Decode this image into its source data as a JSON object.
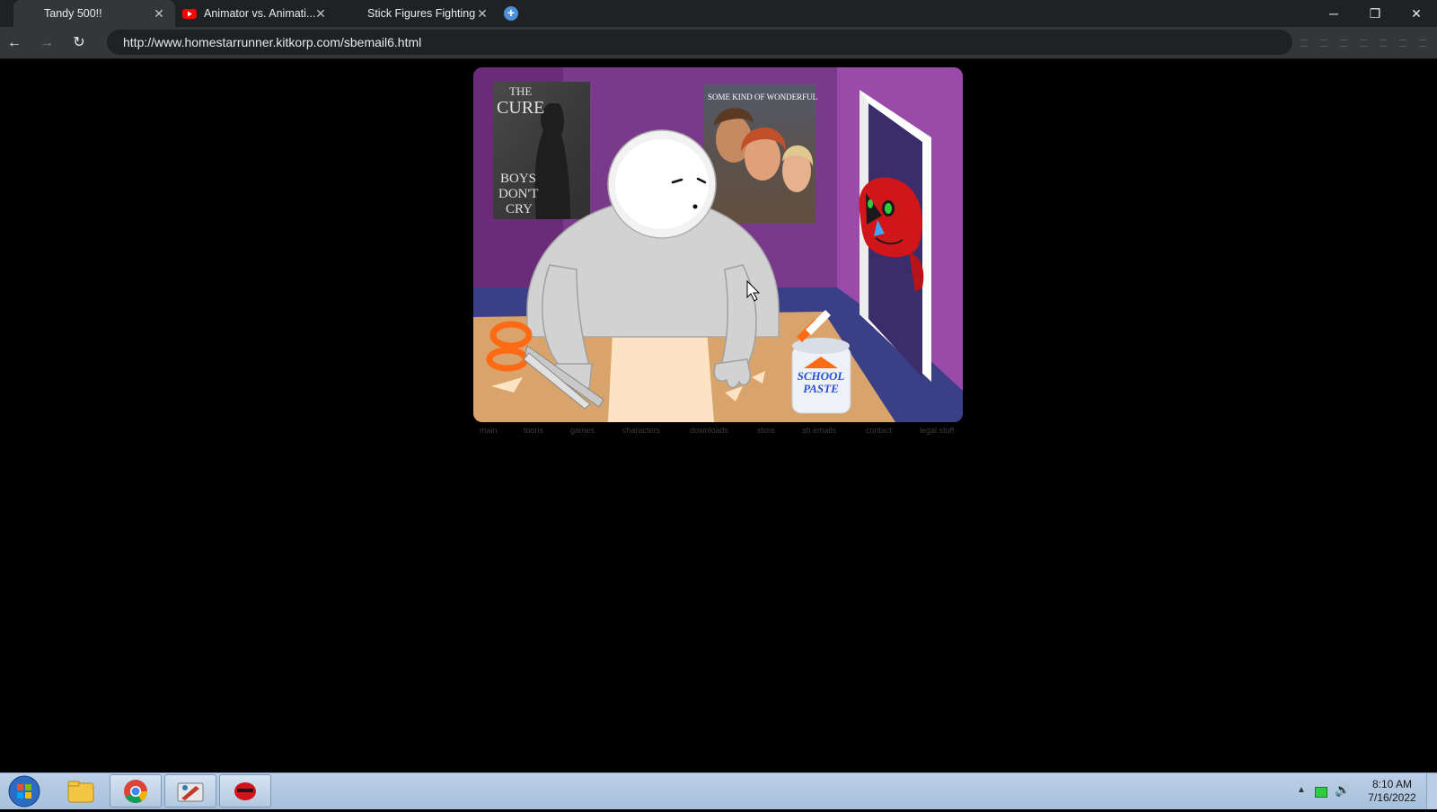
{
  "browser": {
    "tabs": [
      {
        "title": "Tandy 500!!",
        "active": true,
        "favicon": "none"
      },
      {
        "title": "Animator vs. Animati...",
        "active": false,
        "favicon": "youtube-icon"
      },
      {
        "title": "Stick Figures Fighting",
        "active": false,
        "favicon": "none"
      }
    ],
    "url": "http://www.homestarrunner.kitkorp.com/sbemail6.html"
  },
  "scene": {
    "poster_left": {
      "line1": "THE",
      "line2": "CURE",
      "line3": "BOYS",
      "line4": "DON'T",
      "line5": "CRY"
    },
    "poster_right": {
      "title": "SOME KIND OF WONDERFUL"
    },
    "paste_jar": {
      "line1": "SCHOOL",
      "line2": "PASTE"
    }
  },
  "site_nav": [
    "main",
    "toons",
    "games",
    "characters",
    "downloads",
    "store",
    "sb emails",
    "contact",
    "legal stuff"
  ],
  "taskbar": {
    "time": "8:10 AM",
    "date": "7/16/2022",
    "apps": [
      "start-orb",
      "windows-explorer",
      "google-chrome",
      "paint-app",
      "flash-player"
    ]
  },
  "colors": {
    "wall_purple": "#6e2f7e",
    "desk": "#d8a46c",
    "floor_blue": "#3b3f86",
    "scissors_orange": "#ff6a14",
    "strong_bad_red": "#d0161b"
  }
}
